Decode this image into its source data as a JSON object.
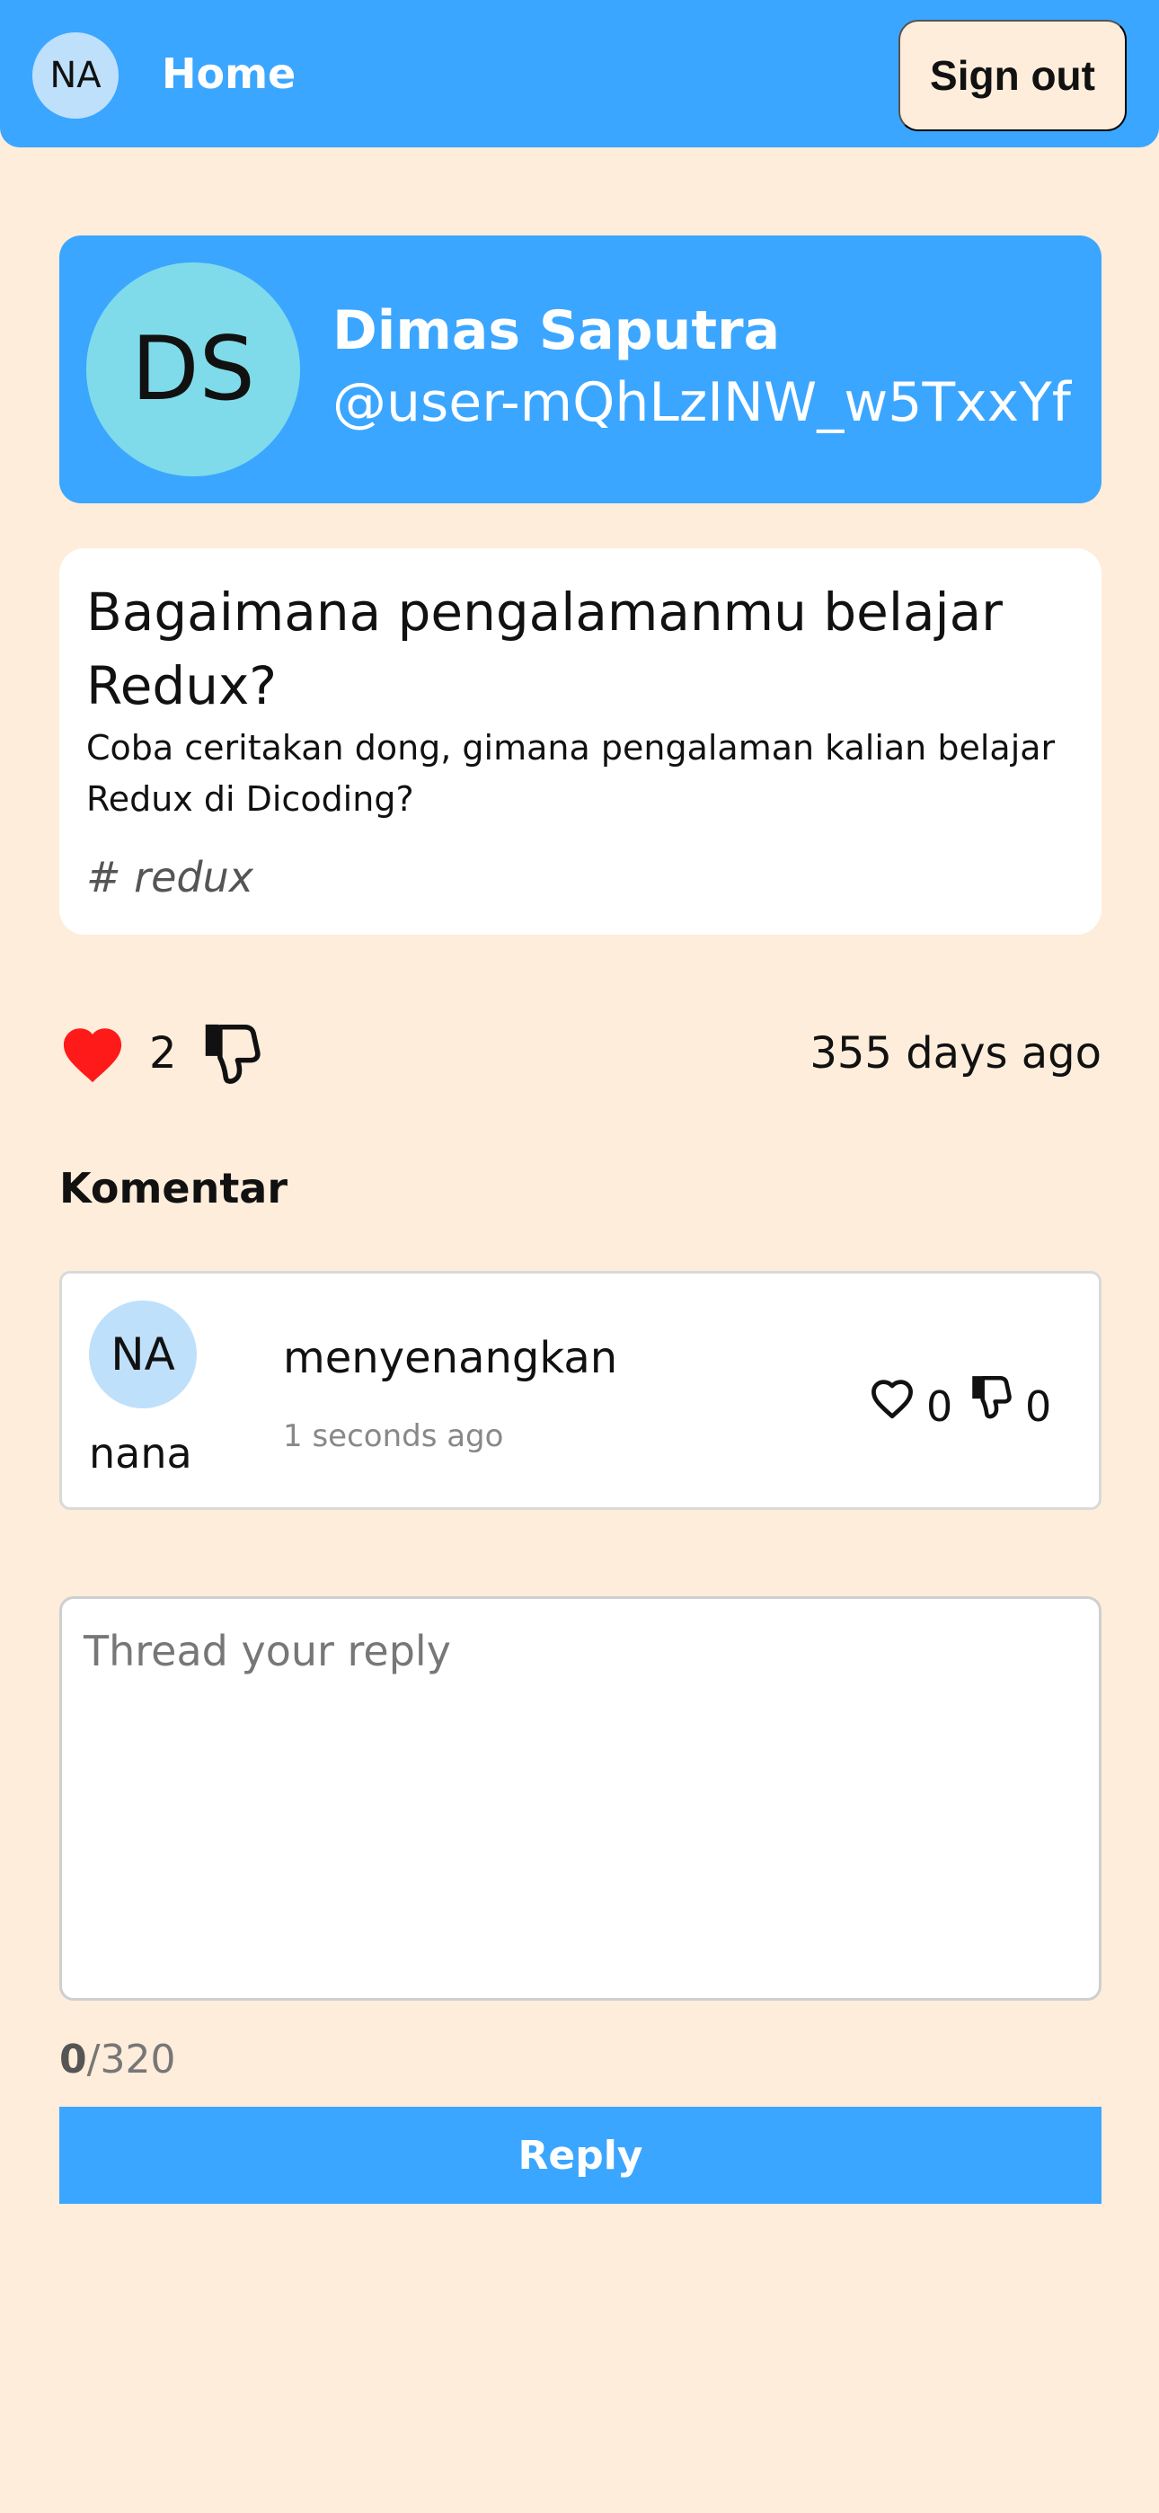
{
  "navbar": {
    "avatar_initials": "NA",
    "home_label": "Home",
    "signout_label": "Sign out"
  },
  "profile": {
    "initials": "DS",
    "name": "Dimas Saputra",
    "handle": "@user-mQhLzINW_w5TxxYf"
  },
  "thread": {
    "title": "Bagaimana pengalamanmu belajar Redux?",
    "body": "Coba ceritakan dong, gimana pengalaman kalian belajar Redux di Dicoding?",
    "tag": "# redux",
    "likes": "2",
    "time": "355 days ago",
    "icons": {
      "like": "heart-icon",
      "dislike": "thumbs-down-icon"
    },
    "colors": {
      "like_active": "#ff1a1a"
    }
  },
  "comments": {
    "heading": "Komentar",
    "items": [
      {
        "avatar_initials": "NA",
        "username": "nana",
        "text": "menyenangkan",
        "time": "1 seconds ago",
        "likes": "0",
        "dislikes": "0"
      }
    ]
  },
  "reply": {
    "placeholder": "Thread your reply",
    "value": "",
    "count": "0",
    "max": "/320",
    "button_label": "Reply"
  },
  "colors": {
    "primary": "#3ba6ff",
    "background": "#ffeddb",
    "avatar_light": "#bfe0fb",
    "avatar_profile": "#7fdbea"
  }
}
